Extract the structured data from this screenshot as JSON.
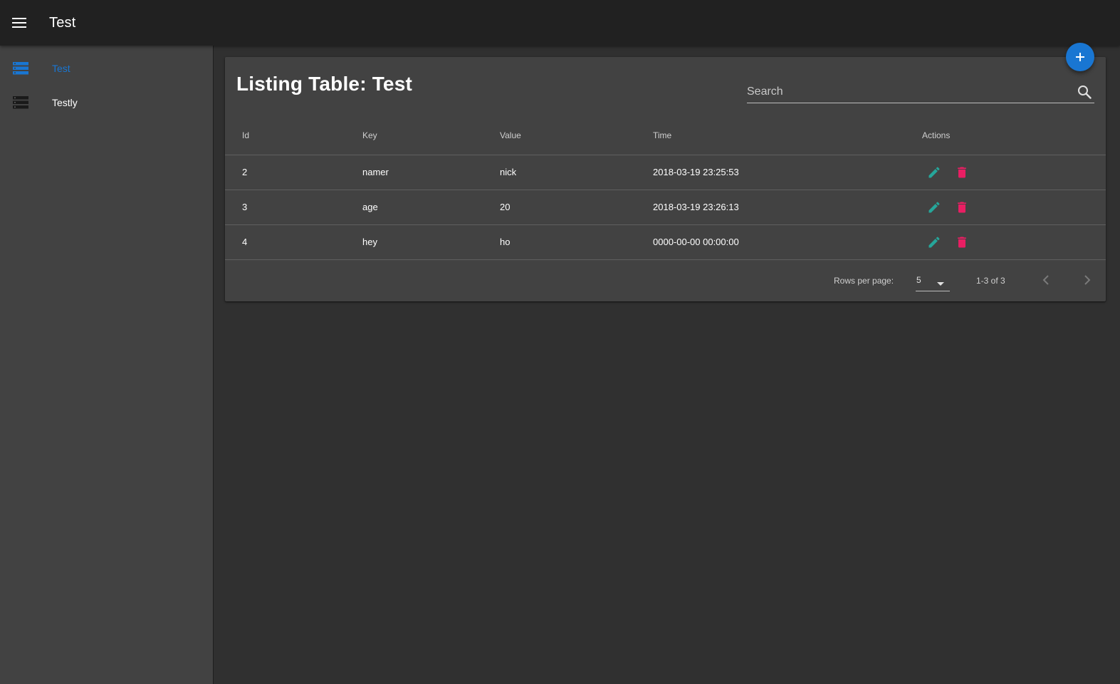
{
  "app": {
    "title": "Test"
  },
  "icons": {
    "menu": "menu-icon",
    "list": "view-list-icon",
    "search": "search-icon",
    "edit": "pencil-icon",
    "delete": "trash-icon",
    "add": "plus-icon",
    "prev": "chevron-left-icon",
    "next": "chevron-right-icon"
  },
  "colors": {
    "accent": "#1976d2",
    "edit": "#26a69a",
    "delete": "#e91e63",
    "appbar": "#212121",
    "surface": "#424242",
    "background": "#303030"
  },
  "sidebar": {
    "items": [
      {
        "label": "Test",
        "active": true
      },
      {
        "label": "Testly",
        "active": false
      }
    ]
  },
  "main": {
    "title": "Listing Table: Test",
    "search": {
      "placeholder": "Search",
      "value": ""
    },
    "table": {
      "columns": [
        "Id",
        "Key",
        "Value",
        "Time",
        "Actions"
      ],
      "rows": [
        {
          "id": "2",
          "key": "namer",
          "value": "nick",
          "time": "2018-03-19 23:25:53"
        },
        {
          "id": "3",
          "key": "age",
          "value": "20",
          "time": "2018-03-19 23:26:13"
        },
        {
          "id": "4",
          "key": "hey",
          "value": "ho",
          "time": "0000-00-00 00:00:00"
        }
      ]
    },
    "pagination": {
      "rows_per_page_label": "Rows per page:",
      "rows_per_page": "5",
      "range": "1-3 of 3"
    }
  }
}
